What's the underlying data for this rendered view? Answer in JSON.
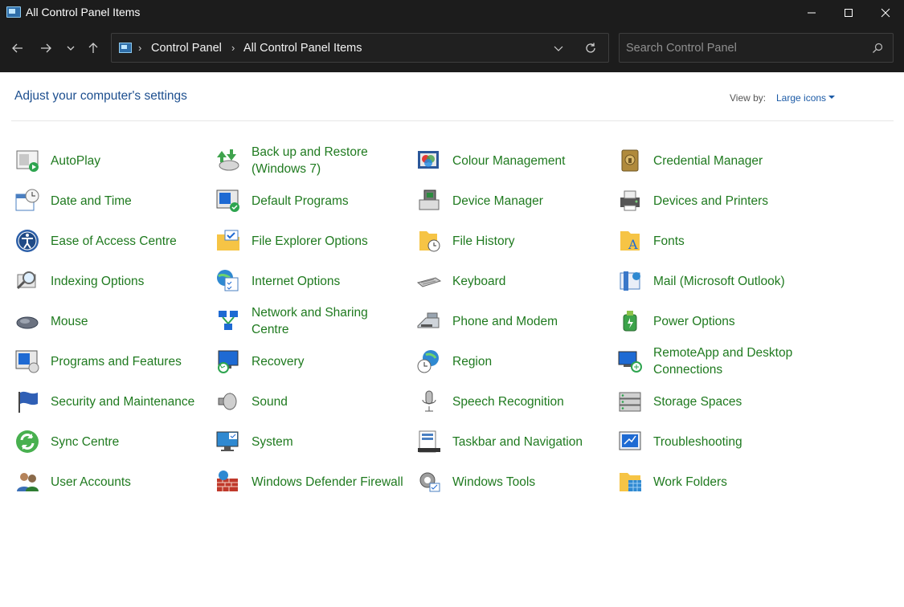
{
  "window": {
    "title": "All Control Panel Items"
  },
  "nav": {
    "breadcrumbs": [
      "Control Panel",
      "All Control Panel Items"
    ],
    "search_placeholder": "Search Control Panel"
  },
  "header": {
    "heading": "Adjust your computer's settings",
    "view_by_label": "View by:",
    "view_by_value": "Large icons"
  },
  "items": [
    {
      "label": "AutoPlay",
      "icon": "autoplay-icon"
    },
    {
      "label": "Back up and Restore (Windows 7)",
      "icon": "backup-restore-icon"
    },
    {
      "label": "Colour Management",
      "icon": "colour-management-icon"
    },
    {
      "label": "Credential Manager",
      "icon": "credential-manager-icon"
    },
    {
      "label": "Date and Time",
      "icon": "date-time-icon"
    },
    {
      "label": "Default Programs",
      "icon": "default-programs-icon"
    },
    {
      "label": "Device Manager",
      "icon": "device-manager-icon"
    },
    {
      "label": "Devices and Printers",
      "icon": "printer-icon"
    },
    {
      "label": "Ease of Access Centre",
      "icon": "ease-of-access-icon"
    },
    {
      "label": "File Explorer Options",
      "icon": "folder-options-icon"
    },
    {
      "label": "File History",
      "icon": "file-history-icon"
    },
    {
      "label": "Fonts",
      "icon": "fonts-icon"
    },
    {
      "label": "Indexing Options",
      "icon": "indexing-icon"
    },
    {
      "label": "Internet Options",
      "icon": "internet-options-icon"
    },
    {
      "label": "Keyboard",
      "icon": "keyboard-icon"
    },
    {
      "label": "Mail (Microsoft Outlook)",
      "icon": "mail-icon"
    },
    {
      "label": "Mouse",
      "icon": "mouse-icon"
    },
    {
      "label": "Network and Sharing Centre",
      "icon": "network-icon"
    },
    {
      "label": "Phone and Modem",
      "icon": "phone-modem-icon"
    },
    {
      "label": "Power Options",
      "icon": "power-options-icon"
    },
    {
      "label": "Programs and Features",
      "icon": "programs-features-icon"
    },
    {
      "label": "Recovery",
      "icon": "recovery-icon"
    },
    {
      "label": "Region",
      "icon": "region-icon"
    },
    {
      "label": "RemoteApp and Desktop Connections",
      "icon": "remoteapp-icon"
    },
    {
      "label": "Security and Maintenance",
      "icon": "security-flag-icon"
    },
    {
      "label": "Sound",
      "icon": "sound-icon"
    },
    {
      "label": "Speech Recognition",
      "icon": "microphone-icon"
    },
    {
      "label": "Storage Spaces",
      "icon": "storage-spaces-icon"
    },
    {
      "label": "Sync Centre",
      "icon": "sync-centre-icon"
    },
    {
      "label": "System",
      "icon": "system-icon"
    },
    {
      "label": "Taskbar and Navigation",
      "icon": "taskbar-icon"
    },
    {
      "label": "Troubleshooting",
      "icon": "troubleshooting-icon"
    },
    {
      "label": "User Accounts",
      "icon": "user-accounts-icon"
    },
    {
      "label": "Windows Defender Firewall",
      "icon": "firewall-icon"
    },
    {
      "label": "Windows Tools",
      "icon": "windows-tools-icon"
    },
    {
      "label": "Work Folders",
      "icon": "work-folders-icon"
    }
  ],
  "colors": {
    "chrome": "#1c1c1c",
    "link_green": "#1f7a1f",
    "heading_blue": "#1d4f8f"
  }
}
